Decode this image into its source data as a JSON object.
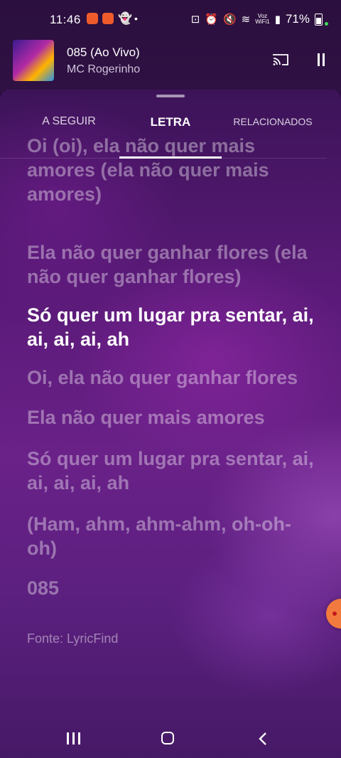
{
  "status_bar": {
    "time": "11:46",
    "voz": "Voz",
    "wifi": "WiFi1",
    "battery": "71%"
  },
  "mini_player": {
    "title": "085 (Ao Vivo)",
    "artist": "MC Rogerinho"
  },
  "tabs": [
    {
      "label": "A SEGUIR"
    },
    {
      "label": "LETRA"
    },
    {
      "label": "RELACIONADOS"
    }
  ],
  "lyrics": {
    "lines": [
      "Oi (oi), ela não quer mais amores (ela não quer mais amores)",
      "Ela não quer ganhar flores (ela não quer ganhar flores)",
      "Só quer um lugar pra sentar, ai, ai, ai, ai, ah",
      "Oi, ela não quer ganhar flores",
      "Ela não quer mais amores",
      "Só quer um lugar pra sentar, ai, ai, ai, ai, ah",
      "(Ham, ahm, ahm-ahm, oh-oh-oh)",
      "085"
    ],
    "active_index": 2,
    "source": "Fonte: LyricFind"
  },
  "colors": {
    "background_top": "#2b0f3e",
    "sheet_mid": "#6a2188",
    "active_text": "#ffffff",
    "inactive_text": "rgba(255,255,255,0.38)"
  }
}
